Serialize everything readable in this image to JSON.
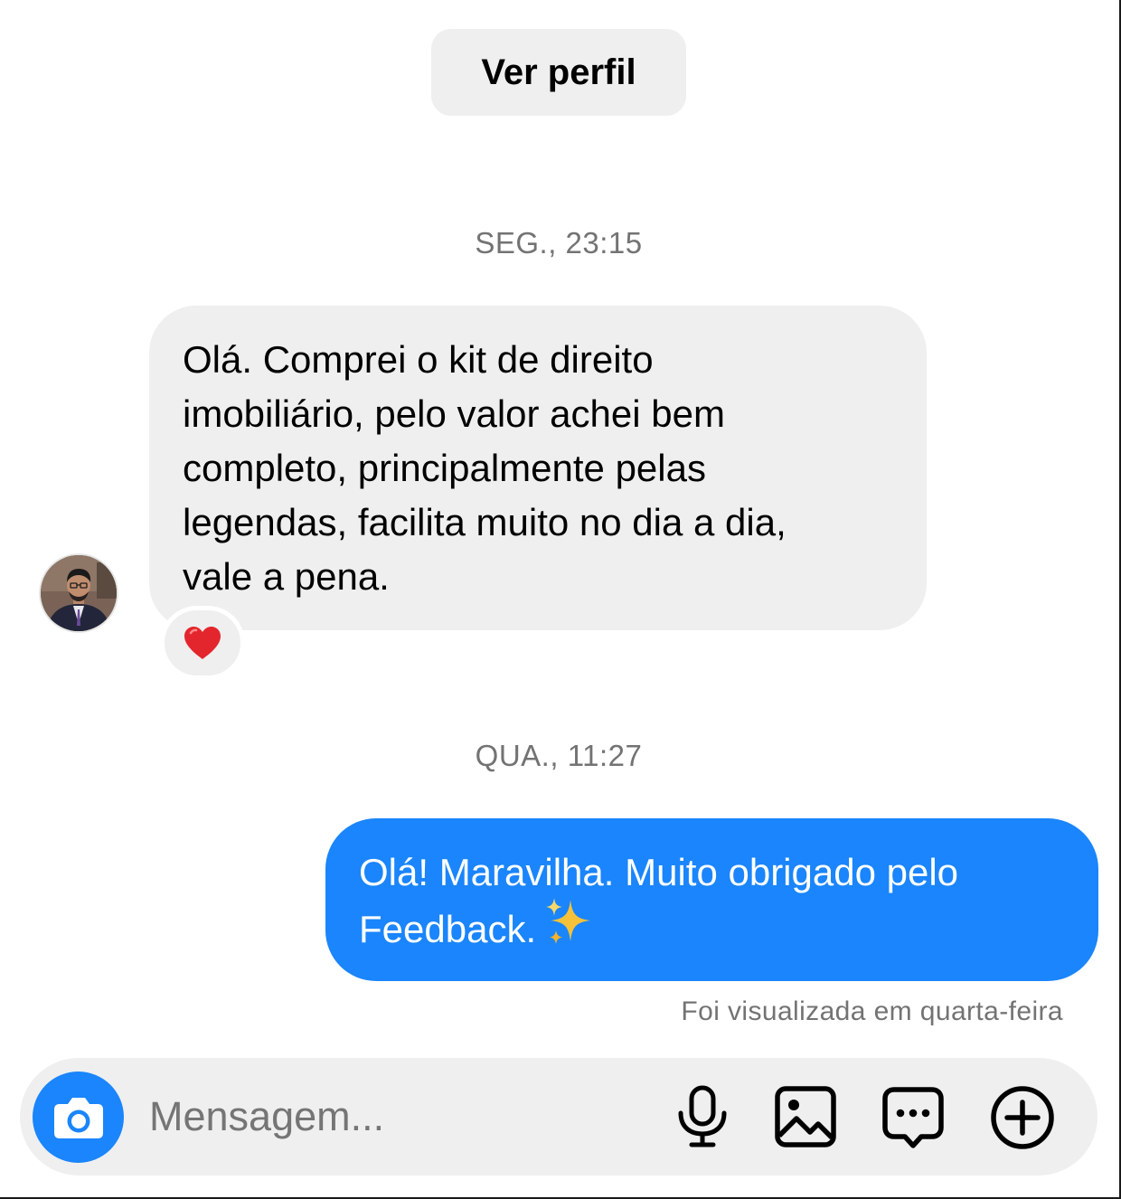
{
  "header": {
    "view_profile_label": "Ver perfil"
  },
  "thread": {
    "timestamp_1": "SEG., 23:15",
    "incoming_message": {
      "lines": [
        "Olá. Comprei o kit de direito",
        "imobiliário, pelo valor achei bem",
        "completo, principalmente pelas",
        "legendas, facilita muito no dia a dia,",
        "vale a pena."
      ],
      "reaction": "heart"
    },
    "timestamp_2": "QUA., 11:27",
    "outgoing_message": {
      "lines": [
        "Olá! Maravilha. Muito obrigado pelo",
        "Feedback."
      ],
      "emoji": "sparkles"
    },
    "seen_status": "Foi visualizada em quarta-feira"
  },
  "composer": {
    "placeholder": "Mensagem...",
    "icons": [
      "camera-icon",
      "microphone-icon",
      "image-icon",
      "chat-bubble-icon",
      "plus-circle-icon"
    ]
  },
  "colors": {
    "outgoing_bubble": "#1a85fc",
    "incoming_bubble": "#efefef",
    "camera_button": "#1a85fc",
    "muted_text": "#737373",
    "heart": "#e3262d"
  }
}
